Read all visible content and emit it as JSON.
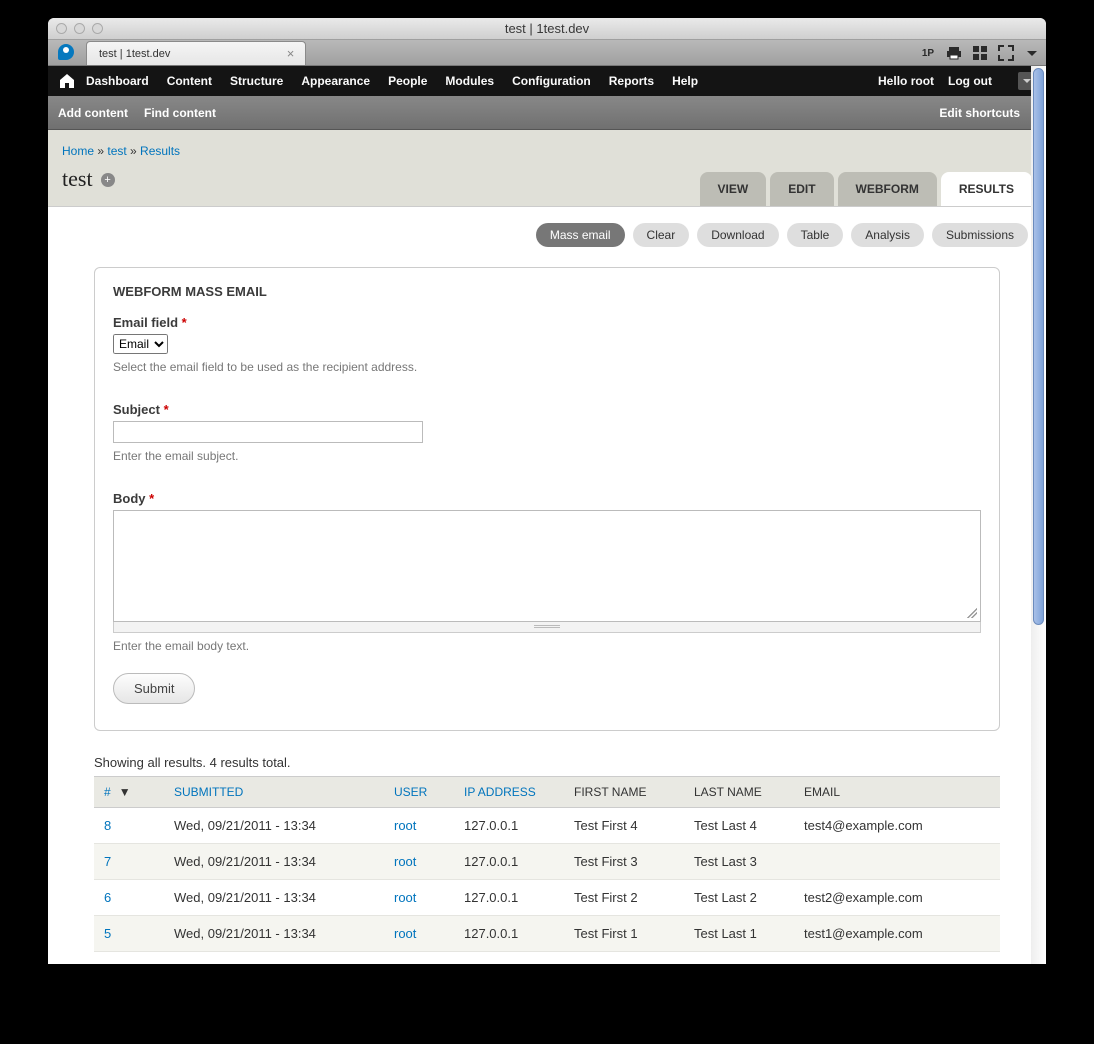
{
  "window": {
    "title": "test | 1test.dev"
  },
  "browser_tab": {
    "label": "test | 1test.dev"
  },
  "toolbar_icons": [
    "onepassword",
    "print",
    "grid",
    "fullscreen",
    "dropdown"
  ],
  "admin_menu": {
    "items": [
      "Dashboard",
      "Content",
      "Structure",
      "Appearance",
      "People",
      "Modules",
      "Configuration",
      "Reports",
      "Help"
    ],
    "hello_prefix": "Hello ",
    "hello_user": "root",
    "logout": "Log out"
  },
  "shortcut_bar": {
    "items": [
      "Add content",
      "Find content"
    ],
    "right": "Edit shortcuts"
  },
  "breadcrumb": {
    "home": "Home",
    "sep": " » ",
    "test": "test",
    "results": "Results"
  },
  "page": {
    "title": "test"
  },
  "main_tabs": {
    "items": [
      "VIEW",
      "EDIT",
      "WEBFORM",
      "RESULTS"
    ],
    "active_index": 3
  },
  "sub_tabs": {
    "items": [
      "Mass email",
      "Clear",
      "Download",
      "Table",
      "Analysis",
      "Submissions"
    ],
    "active_index": 0
  },
  "form": {
    "heading": "WEBFORM MASS EMAIL",
    "email_field": {
      "label": "Email field",
      "options": [
        "Email"
      ],
      "selected": "Email",
      "help": "Select the email field to be used as the recipient address."
    },
    "subject": {
      "label": "Subject",
      "value": "",
      "help": "Enter the email subject."
    },
    "body": {
      "label": "Body",
      "value": "",
      "help": "Enter the email body text."
    },
    "submit": "Submit"
  },
  "results": {
    "caption": "Showing all results. 4 results total.",
    "headers": {
      "num": "#",
      "submitted": "SUBMITTED",
      "user": "USER",
      "ip": "IP ADDRESS",
      "first": "FIRST NAME",
      "last": "LAST NAME",
      "email": "EMAIL"
    },
    "rows": [
      {
        "num": "8",
        "submitted": "Wed, 09/21/2011 - 13:34",
        "user": "root",
        "ip": "127.0.0.1",
        "first": "Test First 4",
        "last": "Test Last 4",
        "email": "test4@example.com"
      },
      {
        "num": "7",
        "submitted": "Wed, 09/21/2011 - 13:34",
        "user": "root",
        "ip": "127.0.0.1",
        "first": "Test First 3",
        "last": "Test Last 3",
        "email": ""
      },
      {
        "num": "6",
        "submitted": "Wed, 09/21/2011 - 13:34",
        "user": "root",
        "ip": "127.0.0.1",
        "first": "Test First 2",
        "last": "Test Last 2",
        "email": "test2@example.com"
      },
      {
        "num": "5",
        "submitted": "Wed, 09/21/2011 - 13:34",
        "user": "root",
        "ip": "127.0.0.1",
        "first": "Test First 1",
        "last": "Test Last 1",
        "email": "test1@example.com"
      }
    ]
  }
}
